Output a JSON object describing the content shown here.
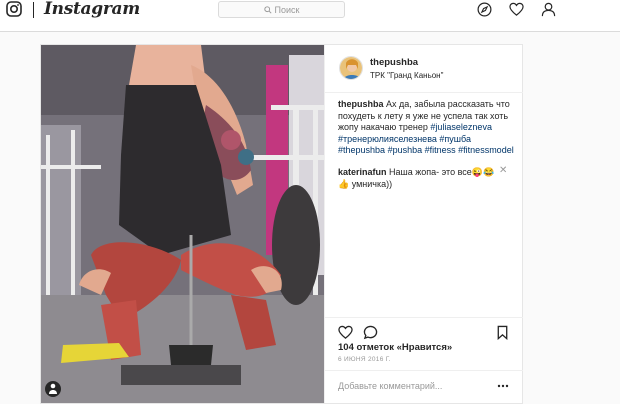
{
  "header": {
    "wordmark": "Instagram",
    "search_placeholder": "Поиск"
  },
  "post": {
    "username": "thepushba",
    "location": "ТРК \"Гранд Каньон\"",
    "caption_user": "thepushba",
    "caption_text": "Ах да, забыла рассказать что похудеть к лету я уже не успела так хоть жопу накачаю тренер",
    "hashtags": [
      "#juliaselezneva",
      "#тренерюлияселезнева",
      "#пушба",
      "#thepushba",
      "#pushba",
      "#fitness",
      "#fitnessmodel"
    ],
    "comment_user": "katerinafun",
    "comment_text": "Наша жопа- это все😜😂👍 умничка))",
    "likes": "104 отметок «Нравится»",
    "date": "6 ИЮНЯ 2016 Г.",
    "add_comment_placeholder": "Добавьте комментарий..."
  },
  "icons": {
    "logo": "instagram-camera-icon",
    "explore": "compass-icon",
    "activity": "heart-icon",
    "profile": "person-icon",
    "like": "heart-outline-icon",
    "comment": "speech-bubble-icon",
    "save": "bookmark-icon",
    "more": "ellipsis-icon",
    "search": "search-icon",
    "close": "close-icon",
    "user_tag": "user-tag-icon"
  }
}
